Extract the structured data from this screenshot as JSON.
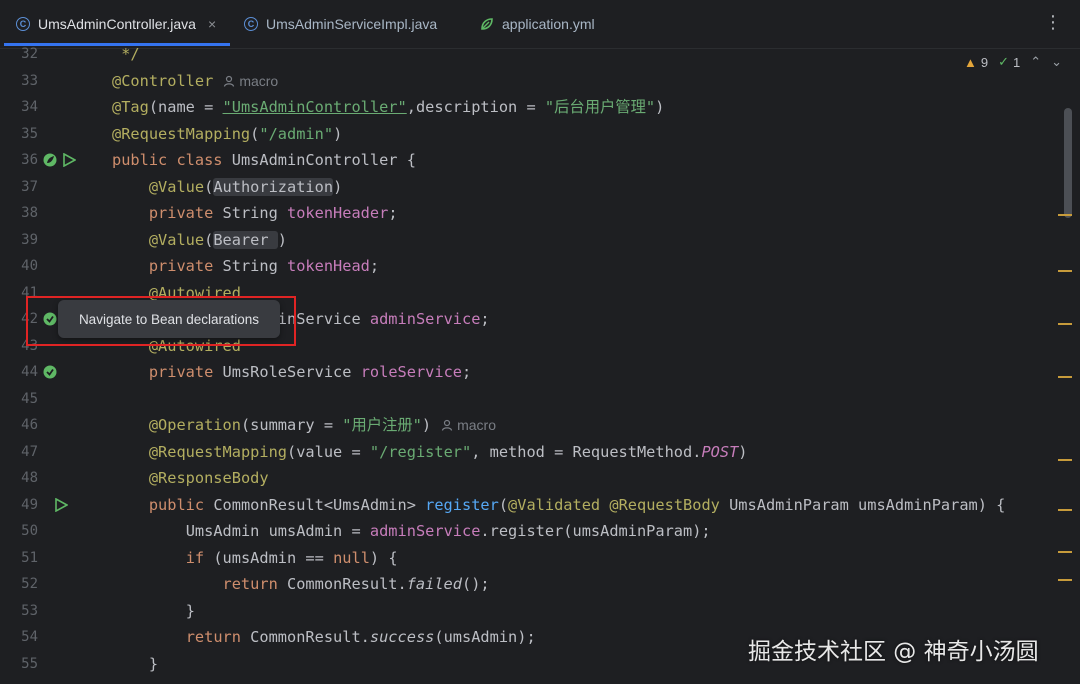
{
  "tabs": [
    {
      "label": "UmsAdminController.java",
      "icon": "class-icon",
      "active": true
    },
    {
      "label": "UmsAdminServiceImpl.java",
      "icon": "class-icon",
      "active": false
    },
    {
      "label": "application.yml",
      "icon": "yaml-leaf-icon",
      "active": false
    }
  ],
  "close_glyph": "×",
  "menu_glyph": "⋮",
  "inspections": {
    "warnings": "9",
    "checks": "1",
    "warn_glyph": "▲",
    "check_glyph": "✓",
    "up": "⌃",
    "down": "⌄"
  },
  "author_hint": "macro",
  "tooltip": "Navigate to Bean declarations",
  "watermark": "掘金技术社区 @ 神奇小汤圆",
  "colors": {
    "accent": "#3574f0",
    "annotation": "#b3ae60",
    "keyword": "#cf8e6d",
    "string": "#6aab73",
    "field": "#c77dbb",
    "highlight_box": "#e02424"
  },
  "lines": {
    "l32": {
      "n": "32",
      "t": " */"
    },
    "l33": {
      "n": "33",
      "a": "@Controller"
    },
    "l34": {
      "n": "34",
      "a": "@Tag",
      "p1": "(name = ",
      "s1": "\"UmsAdminController\"",
      "p2": ",description = ",
      "s2": "\"后台用户管理\"",
      "p3": ")"
    },
    "l35": {
      "n": "35",
      "a": "@RequestMapping",
      "p1": "(",
      "s1": "\"/admin\"",
      "p2": ")"
    },
    "l36": {
      "n": "36",
      "k1": "public class ",
      "p1": "UmsAdminController {"
    },
    "l37": {
      "n": "37",
      "i": "    ",
      "a": "@Value",
      "p1": "(",
      "h": "Authorization",
      "p2": ")"
    },
    "l38": {
      "n": "38",
      "i": "    ",
      "k1": "private ",
      "p1": "String ",
      "f": "tokenHeader",
      "p2": ";"
    },
    "l39": {
      "n": "39",
      "i": "    ",
      "a": "@Value",
      "p1": "(",
      "h": "Bearer ",
      "p2": ")"
    },
    "l40": {
      "n": "40",
      "i": "    ",
      "k1": "private ",
      "p1": "String ",
      "f": "tokenHead",
      "p2": ";"
    },
    "l41": {
      "n": "41",
      "i": "    ",
      "a": "@Autowired"
    },
    "l42": {
      "n": "42",
      "i": "    ",
      "k1": "private ",
      "p1": "UmsAdminService ",
      "f": "adminService",
      "p2": ";"
    },
    "l43": {
      "n": "43",
      "i": "    ",
      "a": "@Autowired"
    },
    "l44": {
      "n": "44",
      "i": "    ",
      "k1": "private ",
      "p1": "UmsRoleService ",
      "f": "roleService",
      "p2": ";"
    },
    "l45": {
      "n": "45"
    },
    "l46": {
      "n": "46",
      "i": "    ",
      "a": "@Operation",
      "p1": "(summary = ",
      "s1": "\"用户注册\"",
      "p2": ")"
    },
    "l47": {
      "n": "47",
      "i": "    ",
      "a": "@RequestMapping",
      "p1": "(value = ",
      "s1": "\"/register\"",
      "p2": ", method = RequestMethod.",
      "f": "POST",
      "p3": ")"
    },
    "l48": {
      "n": "48",
      "i": "    ",
      "a": "@ResponseBody"
    },
    "l49": {
      "n": "49",
      "i": "    ",
      "k1": "public ",
      "p1": "CommonResult<UmsAdmin> ",
      "m": "register",
      "p2": "(",
      "a1": "@Validated",
      "p3": " ",
      "a2": "@RequestBody",
      "p4": " UmsAdminParam umsAdminParam) {"
    },
    "l50": {
      "n": "50",
      "i": "        ",
      "p1": "UmsAdmin umsAdmin = ",
      "f": "adminService",
      "p2": ".register(umsAdminParam);"
    },
    "l51": {
      "n": "51",
      "i": "        ",
      "k1": "if ",
      "p1": "(umsAdmin == ",
      "k2": "null",
      "p2": ") {"
    },
    "l52": {
      "n": "52",
      "i": "            ",
      "k1": "return ",
      "p1": "CommonResult.",
      "it": "failed",
      "p2": "();"
    },
    "l53": {
      "n": "53",
      "i": "        ",
      "p1": "}"
    },
    "l54": {
      "n": "54",
      "i": "        ",
      "k1": "return ",
      "p1": "CommonResult.",
      "it": "success",
      "p2": "(umsAdmin);"
    },
    "l55": {
      "n": "55",
      "i": "    ",
      "p1": "}"
    }
  }
}
